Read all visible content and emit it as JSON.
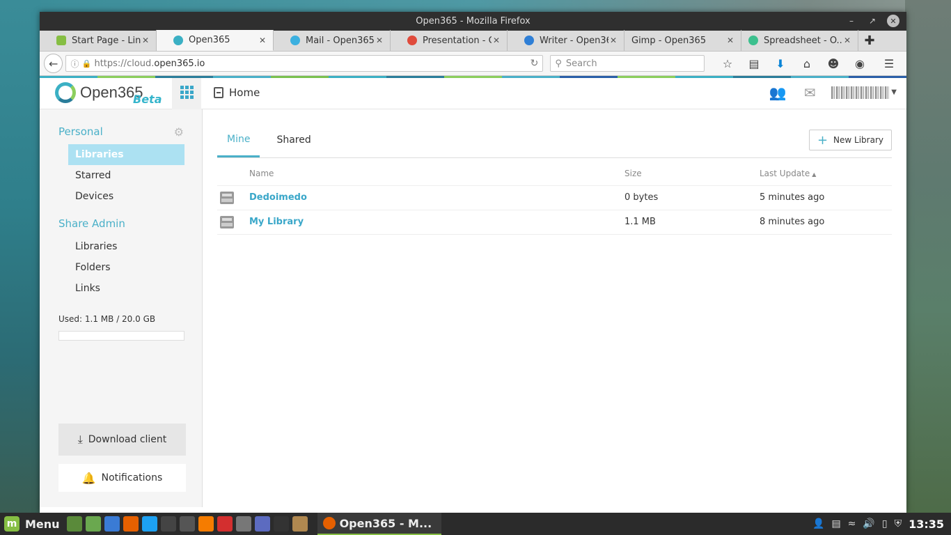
{
  "window": {
    "title": "Open365 - Mozilla Firefox"
  },
  "tabs": [
    {
      "label": "Start Page - Linu...",
      "favicon_color": "#86be43",
      "active": false
    },
    {
      "label": "Open365",
      "favicon_color": "#3bb0c4",
      "active": true
    },
    {
      "label": "Mail - Open365",
      "favicon_color": "#3bb0e0",
      "active": false
    },
    {
      "label": "Presentation - O...",
      "favicon_color": "#e04b3c",
      "active": false
    },
    {
      "label": "Writer - Open365",
      "favicon_color": "#2f7fd6",
      "active": false
    },
    {
      "label": "Gimp - Open365",
      "favicon_color": "#999999",
      "active": false
    },
    {
      "label": "Spreadsheet - O...",
      "favicon_color": "#3cc08e",
      "active": false
    }
  ],
  "navbar": {
    "url_prefix": "https://cloud.",
    "url_domain": "open365.io",
    "search_placeholder": "Search"
  },
  "app": {
    "logo_text": "Open365",
    "logo_beta": "Beta",
    "home_label": "Home",
    "header_colors": [
      "#3bb0c4",
      "#8ccf5d",
      "#2a7d9a",
      "#4ab0c8",
      "#7ac14f",
      "#3bb0c4",
      "#2a7d9a",
      "#8ccf5d",
      "#4ab0c8",
      "#2a5fa8",
      "#8ccf5d",
      "#3bb0c4",
      "#2a7d9a",
      "#4ab0c8",
      "#2a5fa8"
    ]
  },
  "sidebar": {
    "personal_heading": "Personal",
    "personal_items": [
      "Libraries",
      "Starred",
      "Devices"
    ],
    "share_heading": "Share Admin",
    "share_items": [
      "Libraries",
      "Folders",
      "Links"
    ],
    "used_label": "Used: 1.1 MB / 20.0 GB",
    "usage_fraction": 0.0001,
    "download_label": "Download client",
    "notifications_label": "Notifications"
  },
  "main": {
    "tab_mine": "Mine",
    "tab_shared": "Shared",
    "new_library_label": "New Library",
    "columns": {
      "name": "Name",
      "size": "Size",
      "updated": "Last Update"
    },
    "rows": [
      {
        "name": "Dedoimedo",
        "size": "0 bytes",
        "updated": "5 minutes ago"
      },
      {
        "name": "My Library",
        "size": "1.1 MB",
        "updated": "8 minutes ago"
      }
    ]
  },
  "taskbar": {
    "menu_label": "Menu",
    "window_label": "Open365 - M...",
    "clock": "13:35",
    "app_colors": [
      "#5a8a3a",
      "#6aa84f",
      "#3a7bd5",
      "#e66000",
      "#1da1f2",
      "#444444",
      "#555555",
      "#f57c00",
      "#d32f2f",
      "#777777",
      "#5c6bc0",
      "#333333",
      "#b08850"
    ]
  }
}
